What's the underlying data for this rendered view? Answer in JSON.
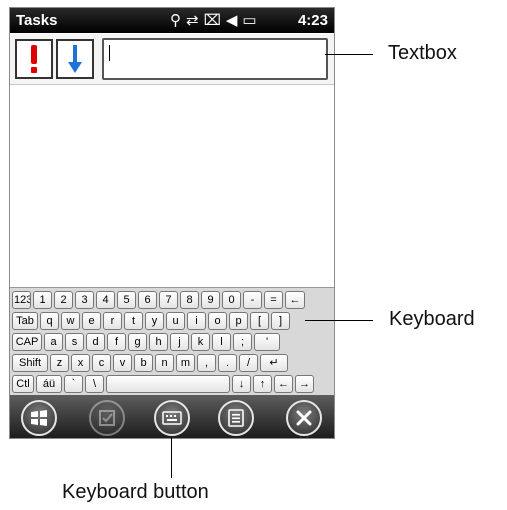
{
  "status_bar": {
    "title": "Tasks",
    "time": "4:23",
    "icons": [
      "antenna-icon",
      "sync-icon",
      "no-connection-icon",
      "speaker-icon",
      "battery-icon"
    ]
  },
  "toolbar": {
    "priority_high_icon": "exclamation-icon",
    "priority_low_icon": "down-arrow-icon"
  },
  "textbox": {
    "value": ""
  },
  "keyboard": {
    "rows": [
      [
        "123",
        "1",
        "2",
        "3",
        "4",
        "5",
        "6",
        "7",
        "8",
        "9",
        "0",
        "-",
        "=",
        "←"
      ],
      [
        "Tab",
        "q",
        "w",
        "e",
        "r",
        "t",
        "y",
        "u",
        "i",
        "o",
        "p",
        "[",
        "]"
      ],
      [
        "CAP",
        "a",
        "s",
        "d",
        "f",
        "g",
        "h",
        "j",
        "k",
        "l",
        ";",
        "'"
      ],
      [
        "Shift",
        "z",
        "x",
        "c",
        "v",
        "b",
        "n",
        "m",
        ",",
        ".",
        "/",
        "↵"
      ],
      [
        "Ctl",
        "áü",
        "`",
        "\\",
        "",
        "↓",
        "↑",
        "←",
        "→"
      ]
    ]
  },
  "softkeys": [
    "windows-start-icon",
    "tasks-checkbox-icon",
    "keyboard-icon",
    "menu-icon",
    "close-icon"
  ],
  "callouts": {
    "textbox": "Textbox",
    "keyboard": "Keyboard",
    "keyboard_button": "Keyboard button"
  },
  "colors": {
    "status_bg": "#000000",
    "exclamation": "#e00000",
    "down_arrow": "#1e73d8",
    "softbar_bg": "#2f2f2f"
  }
}
